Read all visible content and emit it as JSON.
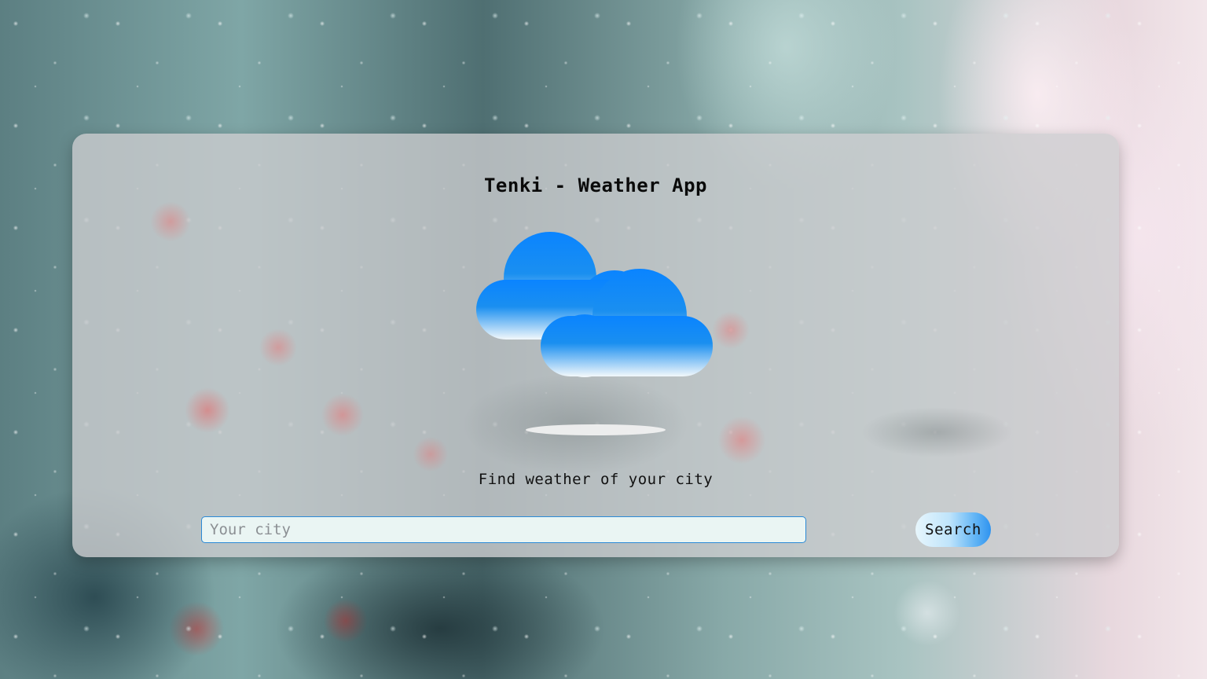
{
  "app": {
    "title": "Tenki - Weather App",
    "subtitle": "Find weather of your city"
  },
  "weather_icon": {
    "name": "cloudy-icon",
    "colors": {
      "top": "#0a84ff",
      "bottom": "#eef6fb"
    }
  },
  "search": {
    "placeholder": "Your city",
    "value": "",
    "button_label": "Search"
  },
  "colors": {
    "accent": "#2f93ef",
    "input_border": "#2b8ad6",
    "input_bg": "#eaf5f3",
    "card_bg": "rgba(205,205,207,0.78)"
  }
}
